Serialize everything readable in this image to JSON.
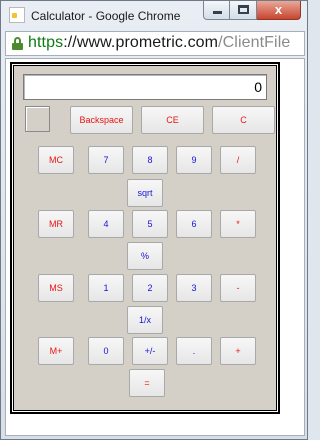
{
  "window": {
    "title": "Calculator - Google Chrome",
    "close_glyph": "x"
  },
  "address_bar": {
    "scheme": "https",
    "rest": "://www.prometric.com",
    "path": "/ClientFile"
  },
  "calculator": {
    "display_value": "0",
    "top_buttons": [
      "Backspace",
      "CE",
      "C"
    ],
    "memory": {
      "mc": "MC",
      "mr": "MR",
      "ms": "MS",
      "mplus": "M+"
    },
    "keys": {
      "seven": "7",
      "eight": "8",
      "nine": "9",
      "divide": "/",
      "sqrt": "sqrt",
      "four": "4",
      "five": "5",
      "six": "6",
      "multiply": "*",
      "percent": "%",
      "one": "1",
      "two": "2",
      "three": "3",
      "minus": "-",
      "reciprocal": "1/x",
      "zero": "0",
      "sign": "+/-",
      "dot": ".",
      "plus": "+",
      "equals": "="
    }
  },
  "colors": {
    "label_red": "#e81515",
    "label_blue": "#1414d8",
    "panel": "#d4d0c8"
  }
}
